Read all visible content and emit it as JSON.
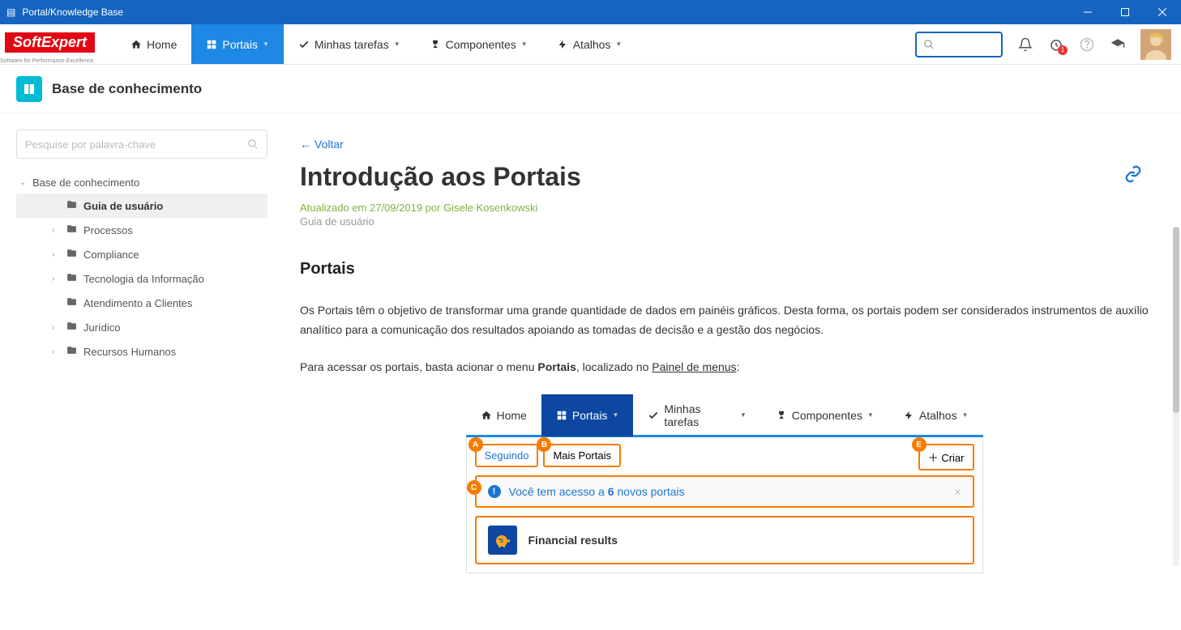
{
  "window": {
    "title": "Portal/Knowledge Base"
  },
  "nav": {
    "home": "Home",
    "portais": "Portais",
    "tarefas": "Minhas tarefas",
    "componentes": "Componentes",
    "atalhos": "Atalhos"
  },
  "badge_count": "1",
  "logo": {
    "main": "SoftExpert",
    "sub": "Software for Performance Excellence"
  },
  "section": {
    "title": "Base de conhecimento"
  },
  "sidebar": {
    "search_placeholder": "Pesquise por palavra-chave",
    "root": "Base de conhecimento",
    "items": [
      {
        "label": "Guia de usuário",
        "selected": true,
        "expand": false
      },
      {
        "label": "Processos",
        "selected": false,
        "expand": true
      },
      {
        "label": "Compliance",
        "selected": false,
        "expand": true
      },
      {
        "label": "Tecnologia da Informação",
        "selected": false,
        "expand": true
      },
      {
        "label": "Atendimento a Clientes",
        "selected": false,
        "expand": false
      },
      {
        "label": "Jurídico",
        "selected": false,
        "expand": true
      },
      {
        "label": "Recursos Humanos",
        "selected": false,
        "expand": true
      }
    ]
  },
  "article": {
    "back": "Voltar",
    "title": "Introdução aos Portais",
    "meta": "Atualizado em 27/09/2019 por Gisele Kosenkowski",
    "category": "Guia de usuário",
    "heading": "Portais",
    "p1": "Os Portais têm o objetivo de transformar uma grande quantidade de dados em painéis gráficos. Desta forma, os portais podem ser considerados instrumentos de auxílio analítico para a comunicação dos resultados apoiando as tomadas de decisão e a gestão dos negócios.",
    "p2_a": "Para acessar os portais, basta acionar o menu ",
    "p2_b": "Portais",
    "p2_c": ", localizado no ",
    "p2_d": "Painel de menus",
    "p2_e": ":"
  },
  "inner": {
    "tabs": {
      "a": "Seguindo",
      "b": "Mais Portais",
      "e": "Criar"
    },
    "markers": {
      "a": "A",
      "b": "B",
      "c": "C",
      "e": "E"
    },
    "notice_a": "Você tem acesso a ",
    "notice_b": "6",
    "notice_c": " novos portais",
    "card": "Financial results"
  }
}
